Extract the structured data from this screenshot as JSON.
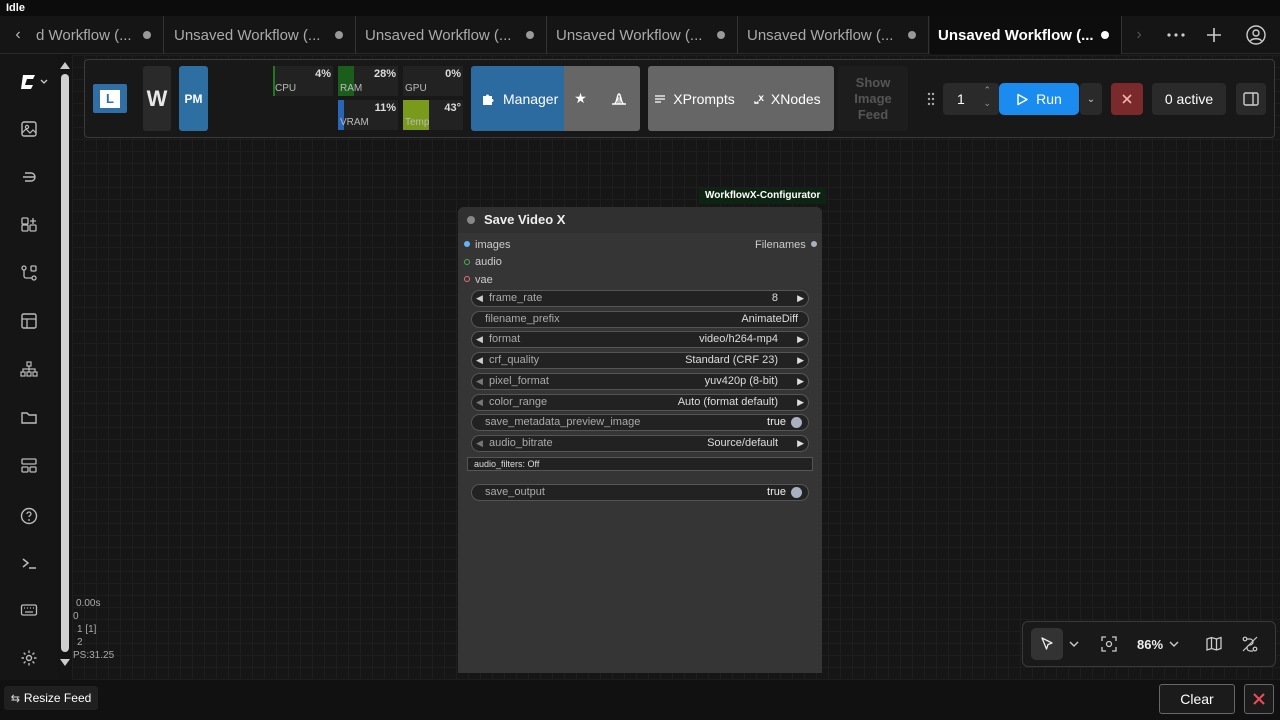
{
  "status": "Idle",
  "tabs": [
    {
      "label": "d Workflow (..."
    },
    {
      "label": "Unsaved Workflow (..."
    },
    {
      "label": "Unsaved Workflow (..."
    },
    {
      "label": "Unsaved Workflow (..."
    },
    {
      "label": "Unsaved Workflow (..."
    },
    {
      "label": "Unsaved Workflow (..."
    }
  ],
  "toolbar": {
    "logo_text": "L",
    "w_text": "W",
    "pm_text": "PM",
    "stats": {
      "cpu": {
        "label": "CPU",
        "value": "4%"
      },
      "ram": {
        "label": "RAM",
        "value": "28%"
      },
      "gpu": {
        "label": "GPU",
        "value": "0%"
      },
      "vram": {
        "label": "VRAM",
        "value": "11%"
      },
      "temp": {
        "label": "Temp",
        "value": "43°"
      }
    },
    "manager_label": "Manager",
    "xprompts_label": "XPrompts",
    "xnodes_label": "XNodes",
    "show_image_feed": "Show Image Feed",
    "queue_count": "1",
    "run_label": "Run",
    "active_label": "0 active"
  },
  "node": {
    "badge": "WorkflowX-Configurator",
    "title": "Save Video X",
    "inputs": [
      "images",
      "audio",
      "vae"
    ],
    "output": "Filenames",
    "widgets": [
      {
        "name": "frame_rate",
        "value": "8"
      },
      {
        "name": "filename_prefix",
        "value": "AnimateDiff"
      },
      {
        "name": "format",
        "value": "video/h264-mp4"
      },
      {
        "name": "crf_quality",
        "value": "Standard (CRF 23)"
      },
      {
        "name": "pixel_format",
        "value": "yuv420p (8-bit)"
      },
      {
        "name": "color_range",
        "value": "Auto (format default)"
      },
      {
        "name": "save_metadata_preview_image",
        "value": "true"
      },
      {
        "name": "audio_bitrate",
        "value": "Source/default"
      }
    ],
    "audio_filters": "audio_filters: Off",
    "save_output": {
      "name": "save_output",
      "value": "true"
    }
  },
  "stats_overlay": [
    "0.00s",
    "0",
    "1 [1]",
    "2",
    "PS:31.25"
  ],
  "zoom": {
    "level": "86%"
  },
  "bottom": {
    "resize_feed": "Resize Feed",
    "clear": "Clear"
  }
}
